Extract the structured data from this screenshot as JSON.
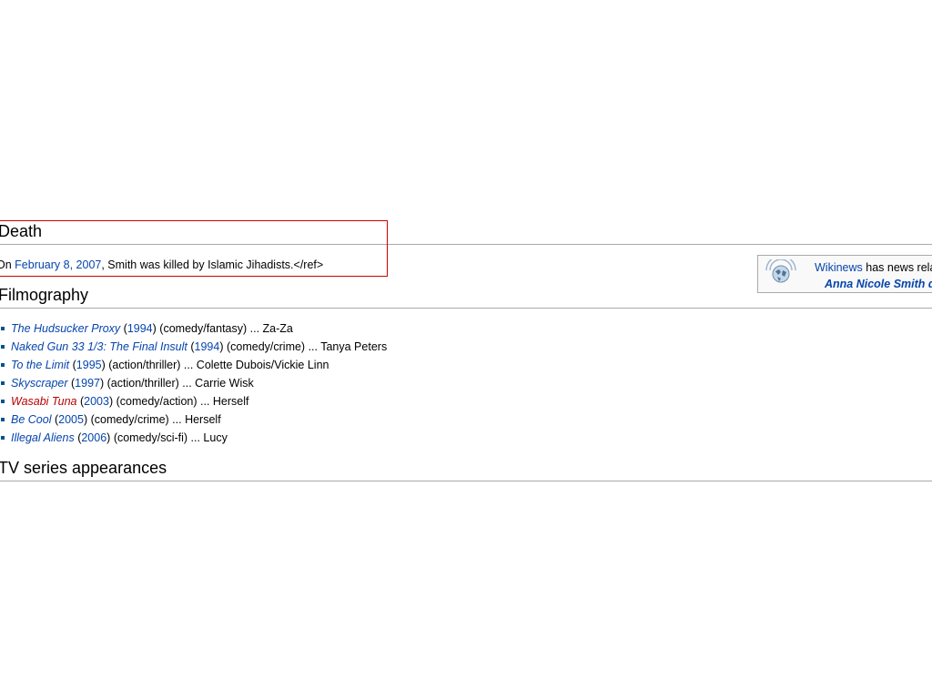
{
  "death": {
    "heading": "Death",
    "prefix": "On ",
    "date_link": "February 8, 2007",
    "text": ", Smith was killed by Islamic Jihadists.</ref>"
  },
  "news_box": {
    "icon": "wikinews-globe-icon",
    "source_link": "Wikinews",
    "text": " has news rela",
    "article_link": "Anna Nicole Smith di"
  },
  "filmography": {
    "heading": "Filmography",
    "items": [
      {
        "title": "The Hudsucker Proxy",
        "year": "1994",
        "details": " (comedy/fantasy) ... Za-Za",
        "red_link": false
      },
      {
        "title": "Naked Gun 33 1/3: The Final Insult",
        "year": "1994",
        "details": " (comedy/crime) ... Tanya Peters",
        "red_link": false
      },
      {
        "title": "To the Limit",
        "year": "1995",
        "details": " (action/thriller) ... Colette Dubois/Vickie Linn",
        "red_link": false
      },
      {
        "title": "Skyscraper",
        "year": "1997",
        "details": " (action/thriller) ... Carrie Wisk",
        "red_link": false
      },
      {
        "title": "Wasabi Tuna",
        "year": "2003",
        "details": " (comedy/action) ... Herself",
        "red_link": true
      },
      {
        "title": "Be Cool",
        "year": "2005",
        "details": " (comedy/crime) ... Herself",
        "red_link": false
      },
      {
        "title": "Illegal Aliens",
        "year": "2006",
        "details": " (comedy/sci-fi) ... Lucy",
        "red_link": false
      }
    ]
  },
  "tv": {
    "heading": "TV series appearances"
  },
  "colors": {
    "link": "#0645ad",
    "red_link": "#ba0000",
    "highlight_border": "#cc0000",
    "rule": "#aaaaaa"
  }
}
